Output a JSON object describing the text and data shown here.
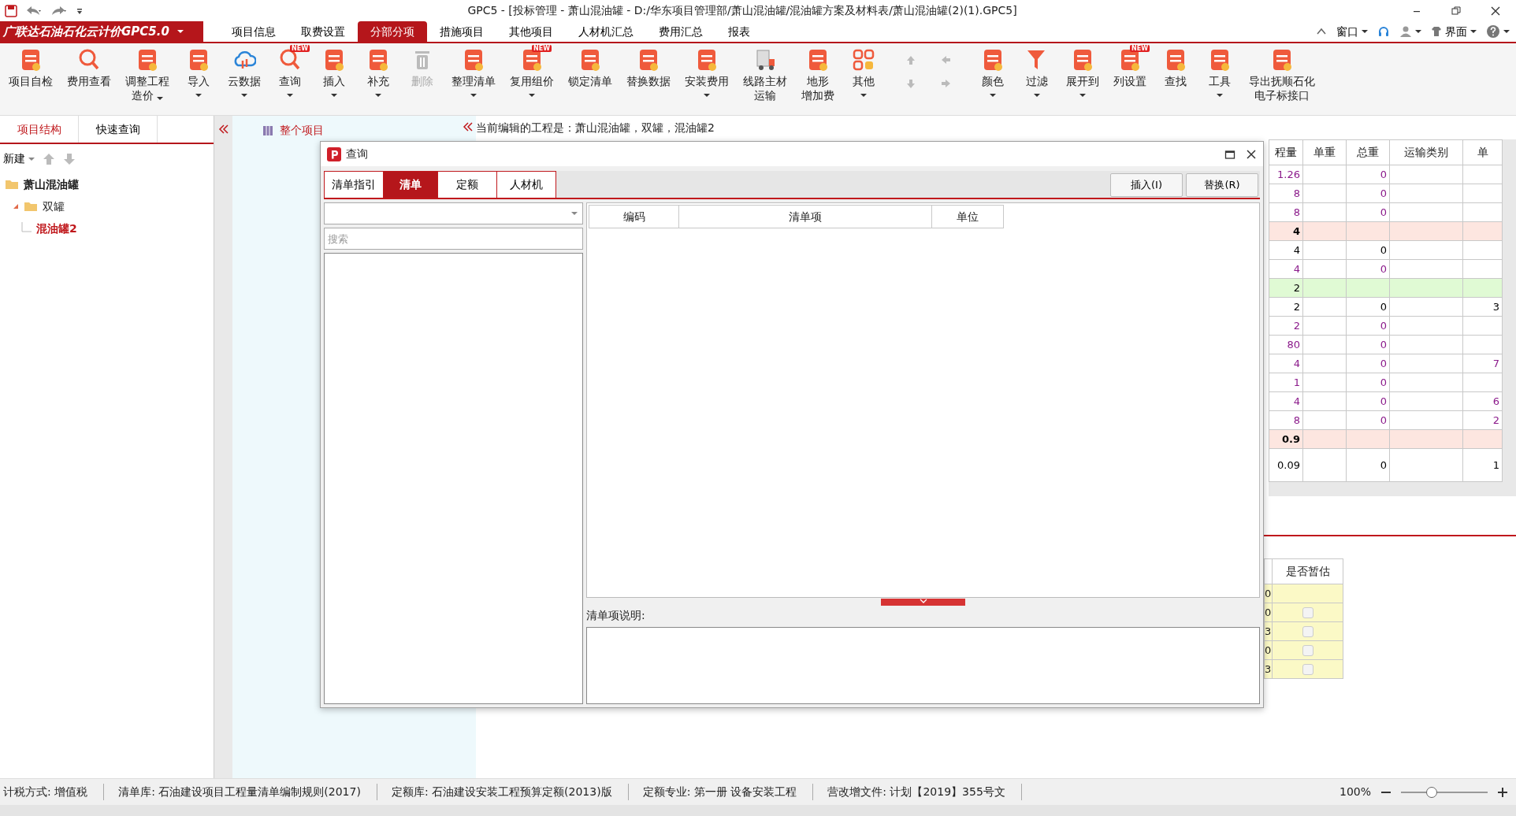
{
  "window": {
    "title": "GPC5 - [投标管理 - 萧山混油罐 - D:/华东项目管理部/萧山混油罐/混油罐方案及材料表/萧山混油罐(2)(1).GPC5]"
  },
  "app_menu": {
    "label": "广联达石油石化云计价GPC5.0"
  },
  "menu_tabs": [
    {
      "label": "项目信息",
      "selected": false
    },
    {
      "label": "取费设置",
      "selected": false
    },
    {
      "label": "分部分项",
      "selected": true
    },
    {
      "label": "措施项目",
      "selected": false
    },
    {
      "label": "其他项目",
      "selected": false
    },
    {
      "label": "人材机汇总",
      "selected": false
    },
    {
      "label": "费用汇总",
      "selected": false
    },
    {
      "label": "报表",
      "selected": false
    }
  ],
  "menu_right": [
    {
      "kind": "collapse",
      "dropdown": false
    },
    {
      "kind": "text",
      "label": "窗口",
      "dropdown": true
    },
    {
      "kind": "headset",
      "dropdown": false
    },
    {
      "kind": "user",
      "dropdown": true
    },
    {
      "kind": "text",
      "label": "界面",
      "dropdown": true
    },
    {
      "kind": "help",
      "dropdown": true
    }
  ],
  "toolbar": [
    {
      "kind": "tool",
      "lines": [
        "项目自检"
      ],
      "dropdown": false,
      "disabled": false
    },
    {
      "kind": "tool",
      "lines": [
        "费用查看"
      ],
      "dropdown": false,
      "disabled": false
    },
    {
      "kind": "tool",
      "lines": [
        "调整工程",
        "造价"
      ],
      "dropdown": true,
      "disabled": false
    },
    {
      "kind": "tool",
      "lines": [
        "导入"
      ],
      "dropdown": true,
      "disabled": false
    },
    {
      "kind": "tool",
      "lines": [
        "云数据"
      ],
      "dropdown": true,
      "disabled": false
    },
    {
      "kind": "tool",
      "lines": [
        "查询"
      ],
      "dropdown": true,
      "disabled": false,
      "badge": "NEW"
    },
    {
      "kind": "tool",
      "lines": [
        "插入"
      ],
      "dropdown": true,
      "disabled": false
    },
    {
      "kind": "tool",
      "lines": [
        "补充"
      ],
      "dropdown": true,
      "disabled": false
    },
    {
      "kind": "tool",
      "lines": [
        "删除"
      ],
      "dropdown": false,
      "disabled": true
    },
    {
      "kind": "tool",
      "lines": [
        "整理清单"
      ],
      "dropdown": true,
      "disabled": false
    },
    {
      "kind": "tool",
      "lines": [
        "复用组价"
      ],
      "dropdown": true,
      "disabled": false,
      "badge": "NEW"
    },
    {
      "kind": "tool",
      "lines": [
        "锁定清单"
      ],
      "dropdown": false,
      "disabled": false
    },
    {
      "kind": "tool",
      "lines": [
        "替换数据"
      ],
      "dropdown": false,
      "disabled": false
    },
    {
      "kind": "tool",
      "lines": [
        "安装费用"
      ],
      "dropdown": true,
      "disabled": false
    },
    {
      "kind": "tool",
      "lines": [
        "线路主材",
        "运输"
      ],
      "dropdown": false,
      "disabled": false
    },
    {
      "kind": "tool",
      "lines": [
        "地形",
        "增加费"
      ],
      "dropdown": false,
      "disabled": false
    },
    {
      "kind": "tool",
      "lines": [
        "其他"
      ],
      "dropdown": true,
      "disabled": false
    },
    {
      "kind": "arrows",
      "disabled": true
    },
    {
      "kind": "tool",
      "lines": [
        "颜色"
      ],
      "dropdown": true,
      "disabled": false
    },
    {
      "kind": "tool",
      "lines": [
        "过滤"
      ],
      "dropdown": true,
      "disabled": false
    },
    {
      "kind": "tool",
      "lines": [
        "展开到"
      ],
      "dropdown": true,
      "disabled": false
    },
    {
      "kind": "tool",
      "lines": [
        "列设置"
      ],
      "dropdown": false,
      "disabled": false,
      "badge": "NEW"
    },
    {
      "kind": "tool",
      "lines": [
        "查找"
      ],
      "dropdown": false,
      "disabled": false
    },
    {
      "kind": "tool",
      "lines": [
        "工具"
      ],
      "dropdown": true,
      "disabled": false
    },
    {
      "kind": "tool",
      "lines": [
        "导出抚顺石化",
        "电子标接口"
      ],
      "dropdown": false,
      "disabled": false
    }
  ],
  "left_tabs": [
    {
      "label": "项目结构",
      "selected": true
    },
    {
      "label": "快速查询",
      "selected": false
    }
  ],
  "left_toolbar": {
    "new_label": "新建"
  },
  "project_tree": [
    {
      "label": "萧山混油罐",
      "selected": false,
      "children": [
        {
          "label": "双罐",
          "selected": false,
          "expanded": true,
          "children": [
            {
              "label": "混油罐2",
              "selected": true
            }
          ]
        }
      ]
    }
  ],
  "unit_tree": [
    {
      "label": "整个项目",
      "selected": true
    }
  ],
  "editing_note": "当前编辑的工程是：萧山混油罐，双罐，混油罐2",
  "dialog": {
    "title": "查询",
    "tabs": [
      {
        "label": "清单指引",
        "selected": false
      },
      {
        "label": "清单",
        "selected": true
      },
      {
        "label": "定额",
        "selected": false
      },
      {
        "label": "人材机",
        "selected": false
      }
    ],
    "buttons": [
      "插入(I)",
      "替换(R)"
    ],
    "search": {
      "placeholder": "搜索"
    },
    "grid": {
      "columns": [
        "编码",
        "清单项",
        "单位"
      ]
    },
    "description_label": "清单项说明:"
  },
  "table": {
    "columns": [
      "程量",
      "单重",
      "总重",
      "运输类别",
      "单"
    ],
    "rows": [
      {
        "kind": "item",
        "color": "#8b1a8b",
        "quantity": "1.26",
        "total_weight": "0"
      },
      {
        "kind": "item",
        "color": "#8b1a8b",
        "quantity": "8",
        "total_weight": "0"
      },
      {
        "kind": "item",
        "color": "#8b1a8b",
        "quantity": "8",
        "total_weight": "0"
      },
      {
        "kind": "summary",
        "color": "#000000",
        "quantity": "4"
      },
      {
        "kind": "item",
        "color": "#000000",
        "quantity": "4",
        "total_weight": "0"
      },
      {
        "kind": "item",
        "color": "#8b1a8b",
        "quantity": "4",
        "total_weight": "0"
      },
      {
        "kind": "group",
        "color": "#000000",
        "quantity": "2"
      },
      {
        "kind": "item",
        "color": "#000000",
        "quantity": "2",
        "total_weight": "0",
        "column_5": "3"
      },
      {
        "kind": "item",
        "color": "#8b1a8b",
        "quantity": "2",
        "total_weight": "0"
      },
      {
        "kind": "item",
        "color": "#8b1a8b",
        "quantity": "80",
        "total_weight": "0"
      },
      {
        "kind": "item",
        "color": "#8b1a8b",
        "quantity": "4",
        "total_weight": "0",
        "column_5": "7"
      },
      {
        "kind": "item",
        "color": "#8b1a8b",
        "quantity": "1",
        "total_weight": "0"
      },
      {
        "kind": "item",
        "color": "#8b1a8b",
        "quantity": "4",
        "total_weight": "0",
        "column_5": "6"
      },
      {
        "kind": "item",
        "color": "#8b1a8b",
        "quantity": "8",
        "total_weight": "0",
        "column_5": "2"
      },
      {
        "kind": "summary",
        "color": "#000000",
        "quantity": "0.9"
      },
      {
        "kind": "tall",
        "color": "#000000",
        "quantity": "0.09",
        "total_weight": "0",
        "column_5": "1"
      }
    ]
  },
  "lower_table": {
    "columns": [
      "是否暂估"
    ],
    "rows": [
      {
        "kind": "blank",
        "column_1": "0"
      },
      {
        "kind": "checkbox",
        "column_1": "0",
        "checked": false
      },
      {
        "kind": "checkbox",
        "column_1": "3",
        "checked": false
      },
      {
        "kind": "checkbox",
        "column_1": "0",
        "checked": false
      },
      {
        "kind": "checkbox",
        "column_1": "3",
        "checked": false
      }
    ]
  },
  "status_bar": {
    "items": [
      "计税方式: 增值税",
      "清单库: 石油建设项目工程量清单编制规则(2017)",
      "定额库: 石油建设安装工程预算定额(2013)版",
      "定额专业: 第一册 设备安装工程",
      "营改增文件: 计划【2019】355号文"
    ],
    "zoom": "100%",
    "zoom_slider": {
      "level": 0.35
    }
  }
}
